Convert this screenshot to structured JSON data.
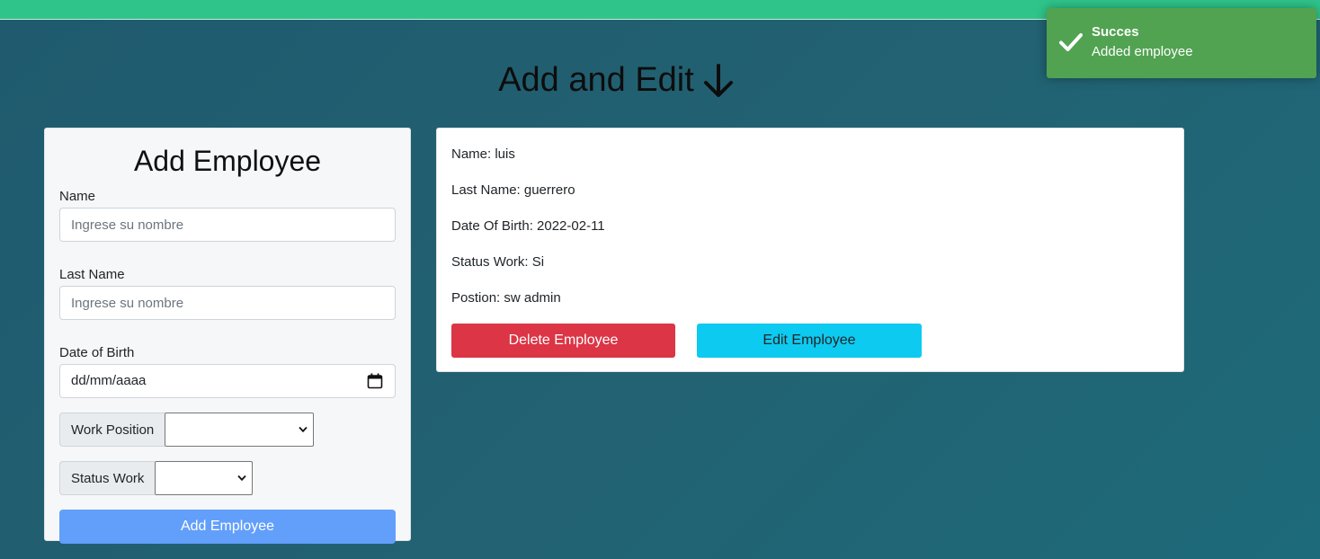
{
  "heading": {
    "title": "Add and Edit"
  },
  "add_form": {
    "title": "Add Employee",
    "name": {
      "label": "Name",
      "placeholder": "Ingrese su nombre",
      "value": ""
    },
    "last_name": {
      "label": "Last Name",
      "placeholder": "Ingrese su nombre",
      "value": ""
    },
    "dob": {
      "label": "Date of Birth",
      "value": "dd/mm/aaaa"
    },
    "work_position": {
      "label": "Work Position",
      "selected": ""
    },
    "status_work": {
      "label": "Status Work",
      "selected": ""
    },
    "submit_label": "Add Employee"
  },
  "employee": {
    "lines": [
      "Name: luis",
      "Last Name: guerrero",
      "Date Of Birth: 2022-02-11",
      "Status Work: Si",
      "Postion: sw admin"
    ],
    "delete_label": "Delete Employee",
    "edit_label": "Edit Employee"
  },
  "toast": {
    "title": "Succes",
    "message": "Added employee",
    "icon": "check-icon"
  },
  "colors": {
    "top_bar": "#2fc58a",
    "background": "#226272",
    "add_button": "#629ffb",
    "delete_button": "#dc3545",
    "edit_button": "#0dcaf0",
    "toast": "#51a351"
  }
}
